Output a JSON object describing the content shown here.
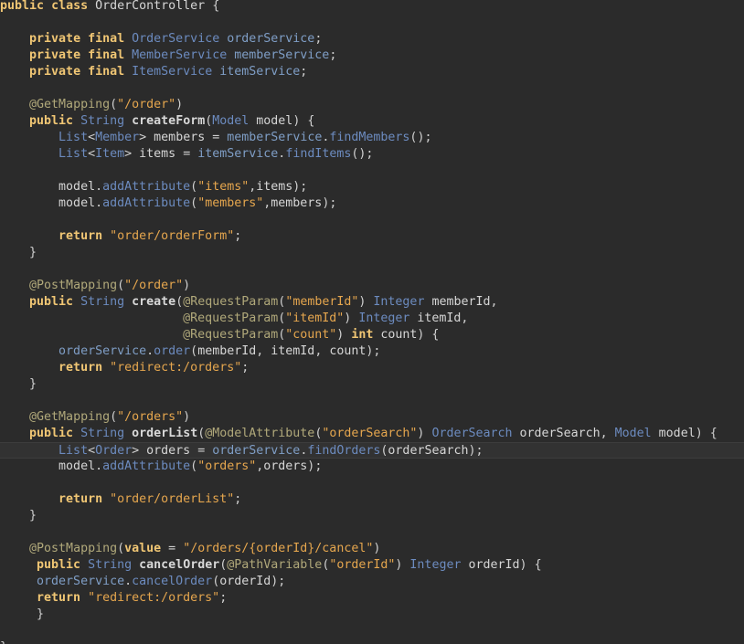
{
  "editor": {
    "language": "Java",
    "cursor_line": 27,
    "lines": [
      "public class OrderController {",
      "",
      "    private final OrderService orderService;",
      "    private final MemberService memberService;",
      "    private final ItemService itemService;",
      "",
      "    @GetMapping(\"/order\")",
      "    public String createForm(Model model) {",
      "        List<Member> members = memberService.findMembers();",
      "        List<Item> items = itemService.findItems();",
      "",
      "        model.addAttribute(\"items\",items);",
      "        model.addAttribute(\"members\",members);",
      "",
      "        return \"order/orderForm\";",
      "    }",
      "",
      "    @PostMapping(\"/order\")",
      "    public String create(@RequestParam(\"memberId\") Integer memberId,",
      "                         @RequestParam(\"itemId\") Integer itemId,",
      "                         @RequestParam(\"count\") int count) {",
      "        orderService.order(memberId, itemId, count);",
      "        return \"redirect:/orders\";",
      "    }",
      "",
      "    @GetMapping(\"/orders\")",
      "    public String orderList(@ModelAttribute(\"orderSearch\") OrderSearch orderSearch, Model model) {",
      "        List<Order> orders = orderService.findOrders(orderSearch);",
      "        model.addAttribute(\"orders\",orders);",
      "",
      "        return \"order/orderList\";",
      "    }",
      "",
      "    @PostMapping(value = \"/orders/{orderId}/cancel\")",
      "     public String cancelOrder(@PathVariable(\"orderId\") Integer orderId) {",
      "     orderService.cancelOrder(orderId);",
      "     return \"redirect:/orders\";",
      "     }",
      "",
      "}"
    ]
  },
  "colors": {
    "background": "#2b2b2b",
    "keyword": "#f0c674",
    "type": "#6c8bbf",
    "string": "#e5a64e",
    "annotation": "#b0a87a",
    "plain": "#d6d6d6"
  }
}
